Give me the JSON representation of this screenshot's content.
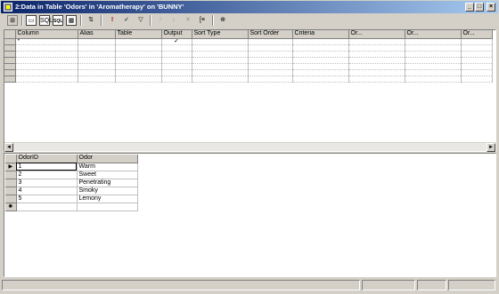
{
  "window": {
    "title": "2:Data in Table 'Odors' in 'Aromatherapy' on 'BUNNY'",
    "controls": {
      "minimize": "_",
      "restore": "□",
      "close": "×"
    }
  },
  "toolbar": {
    "tools": [
      {
        "name": "diagram-pane-icon",
        "glyph": "⊞"
      },
      {
        "name": "grid-pane-icon",
        "glyph": "▭"
      },
      {
        "name": "sql-pane-icon",
        "glyph": "SQL"
      },
      {
        "name": "results-pane-icon",
        "glyph": "▦"
      },
      {
        "name": "change-type-icon",
        "glyph": "⇅"
      },
      {
        "name": "run-icon",
        "glyph": "!"
      },
      {
        "name": "verify-sql-icon",
        "glyph": "✓"
      },
      {
        "name": "filter-icon",
        "glyph": "▽"
      },
      {
        "name": "sort-asc-icon",
        "glyph": "↑"
      },
      {
        "name": "sort-desc-icon",
        "glyph": "↓"
      },
      {
        "name": "remove-filter-icon",
        "glyph": "✕"
      },
      {
        "name": "group-by-icon",
        "glyph": "[≡"
      },
      {
        "name": "add-table-icon",
        "glyph": "⊕"
      }
    ]
  },
  "criteria_grid": {
    "columns": [
      "Column",
      "Alias",
      "Table",
      "Output",
      "Sort Type",
      "Sort Order",
      "Criteria",
      "Or...",
      "Or...",
      "Or..."
    ],
    "rows": [
      [
        "*",
        "",
        "",
        "✓",
        "",
        "",
        "",
        "",
        "",
        ""
      ],
      [
        "",
        "",
        "",
        "",
        "",
        "",
        "",
        "",
        "",
        ""
      ],
      [
        "",
        "",
        "",
        "",
        "",
        "",
        "",
        "",
        "",
        ""
      ],
      [
        "",
        "",
        "",
        "",
        "",
        "",
        "",
        "",
        "",
        ""
      ],
      [
        "",
        "",
        "",
        "",
        "",
        "",
        "",
        "",
        "",
        ""
      ],
      [
        "",
        "",
        "",
        "",
        "",
        "",
        "",
        "",
        "",
        ""
      ],
      [
        "",
        "",
        "",
        "",
        "",
        "",
        "",
        "",
        "",
        ""
      ]
    ],
    "scroll": {
      "left": "◄",
      "right": "►"
    }
  },
  "results": {
    "columns": [
      "OdorID",
      "Odor"
    ],
    "rows": [
      {
        "indicator": "▶",
        "id": "1",
        "odor": "Warm"
      },
      {
        "indicator": "",
        "id": "2",
        "odor": "Sweet"
      },
      {
        "indicator": "",
        "id": "3",
        "odor": "Penetrating"
      },
      {
        "indicator": "",
        "id": "4",
        "odor": "Smoky"
      },
      {
        "indicator": "",
        "id": "5",
        "odor": "Lemony"
      }
    ],
    "new_row": {
      "indicator": "✱",
      "id": "",
      "odor": ""
    }
  }
}
